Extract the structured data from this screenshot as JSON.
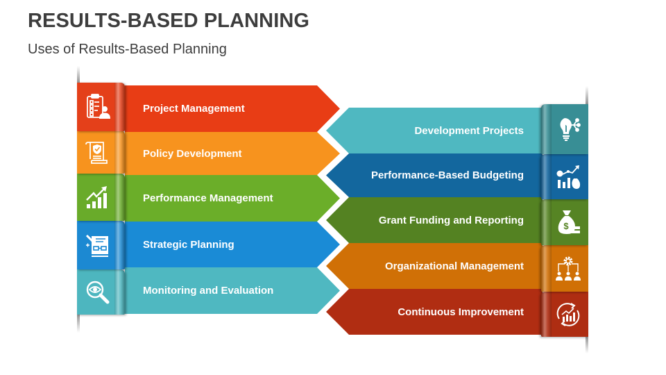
{
  "title": "RESULTS-BASED PLANNING",
  "subtitle": "Uses of Results-Based Planning",
  "left_items": [
    {
      "label": "Project Management",
      "icon": "clipboard-person-icon",
      "band_color": "#E83D15",
      "tab_color": "#E4401A"
    },
    {
      "label": "Policy Development",
      "icon": "certificate-shield-icon",
      "band_color": "#F7931E",
      "tab_color": "#F7931E"
    },
    {
      "label": "Performance Management",
      "icon": "growth-bar-chart-icon",
      "band_color": "#6BAE29",
      "tab_color": "#69AB2A"
    },
    {
      "label": "Strategic Planning",
      "icon": "strategy-board-icon",
      "band_color": "#1A8BD6",
      "tab_color": "#1C89D2"
    },
    {
      "label": "Monitoring and Evaluation",
      "icon": "eye-magnifier-icon",
      "band_color": "#4FB8C1",
      "tab_color": "#4DB6BF"
    }
  ],
  "right_items": [
    {
      "label": "Development Projects",
      "icon": "lightbulb-network-icon",
      "band_color": "#4FB8C1",
      "tab_color": "#388E95"
    },
    {
      "label": "Performance-Based Budgeting",
      "icon": "money-growth-chart-icon",
      "band_color": "#13679E",
      "tab_color": "#14669F"
    },
    {
      "label": "Grant Funding and Reporting",
      "icon": "money-bag-icon",
      "band_color": "#548222",
      "tab_color": "#568424"
    },
    {
      "label": "Organizational Management",
      "icon": "org-chart-gear-icon",
      "band_color": "#D07006",
      "tab_color": "#D07006"
    },
    {
      "label": "Continuous Improvement",
      "icon": "cycle-growth-icon",
      "band_color": "#B02D12",
      "tab_color": "#AE2D12"
    }
  ]
}
